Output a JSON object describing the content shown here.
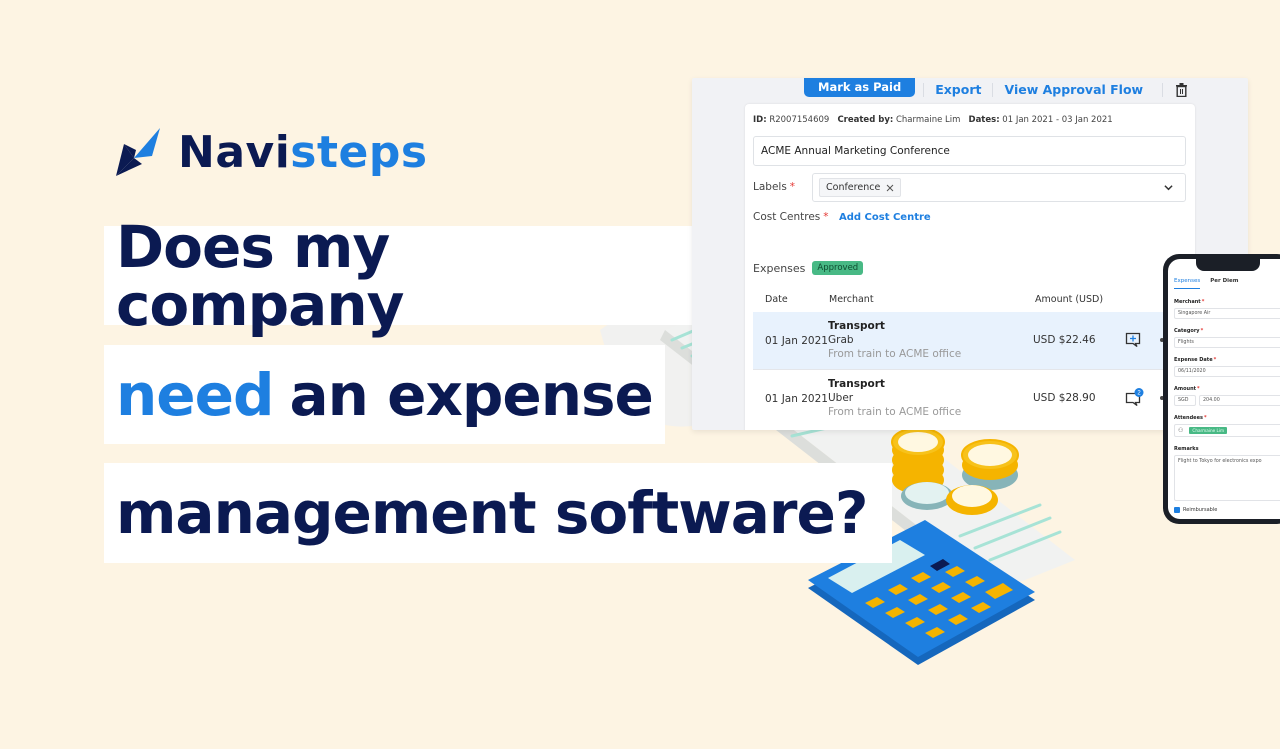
{
  "brand": {
    "name_part1": "Navi",
    "name_part2": "steps",
    "logo_icon": "navisteps-logo-icon",
    "colors": {
      "navy": "#0b1a52",
      "blue": "#1e7fe0",
      "background": "#fdf4e3"
    }
  },
  "headline": {
    "line1": "Does my company",
    "line2_accent": "need",
    "line2_rest": "an expense",
    "line3": "management software?"
  },
  "app": {
    "toolbar": {
      "mark_paid": "Mark as Paid",
      "export": "Export",
      "approval_flow": "View Approval Flow",
      "delete_icon": "trash-icon"
    },
    "report": {
      "id_label": "ID:",
      "id_value": "R2007154609",
      "created_label": "Created by:",
      "created_value": "Charmaine Lim",
      "dates_label": "Dates:",
      "dates_value": "01 Jan 2021 - 03 Jan 2021",
      "title": "ACME Annual Marketing Conference",
      "labels_label": "Labels",
      "labels_chip": "Conference",
      "cost_centres_label": "Cost Centres",
      "add_cost_centre": "Add Cost Centre"
    },
    "expenses": {
      "title": "Expenses",
      "status": "Approved",
      "columns": [
        "Date",
        "Merchant",
        "Amount (USD)"
      ],
      "rows": [
        {
          "date": "01 Jan 2021",
          "category": "Transport",
          "merchant": "Grab",
          "description": "From train to ACME office",
          "amount": "USD $22.46",
          "comment_icon": "add-comment-icon",
          "comment_count": ""
        },
        {
          "date": "01 Jan 2021",
          "category": "Transport",
          "merchant": "Uber",
          "description": "From train to ACME office",
          "amount": "USD $28.90",
          "comment_icon": "comment-icon",
          "comment_count": "2"
        }
      ]
    }
  },
  "mobile": {
    "tabs": [
      "Expenses",
      "Per Diem"
    ],
    "merchant_label": "Merchant",
    "merchant_value": "Singapore Air",
    "category_label": "Category",
    "category_value": "Flights",
    "date_label": "Expense Date",
    "date_value": "06/11/2020",
    "amount_label": "Amount",
    "currency_value": "SGD",
    "amount_value": "204.00",
    "attendees_label": "Attendees",
    "attendee_chip": "Charmaine Lim",
    "remarks_label": "Remarks",
    "remarks_value": "Flight to Tokyo for electronics expo",
    "reimbursable_label": "Reimbursable",
    "reimbursable_checked": true
  }
}
